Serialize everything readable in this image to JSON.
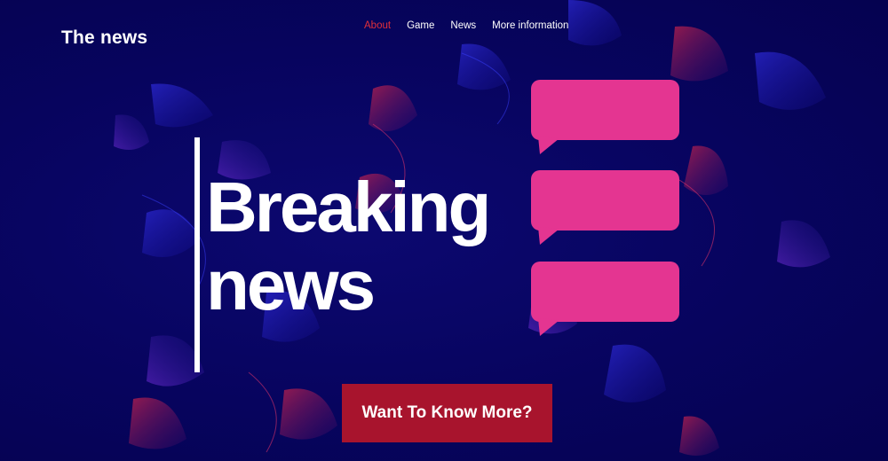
{
  "header": {
    "logo": "The news",
    "nav": [
      {
        "label": "About",
        "active": true
      },
      {
        "label": "Game",
        "active": false
      },
      {
        "label": "News",
        "active": false
      },
      {
        "label": "More information",
        "active": false
      }
    ]
  },
  "hero": {
    "headline_line1": "Breaking",
    "headline_line2": "news",
    "cta_label": "Want To Know More?",
    "bubble_icon": "speech-bubble-icon"
  },
  "colors": {
    "background": "#07035a",
    "nav_active": "#e0303a",
    "bubble": "#e43591",
    "cta": "#a8142d",
    "text": "#ffffff"
  }
}
